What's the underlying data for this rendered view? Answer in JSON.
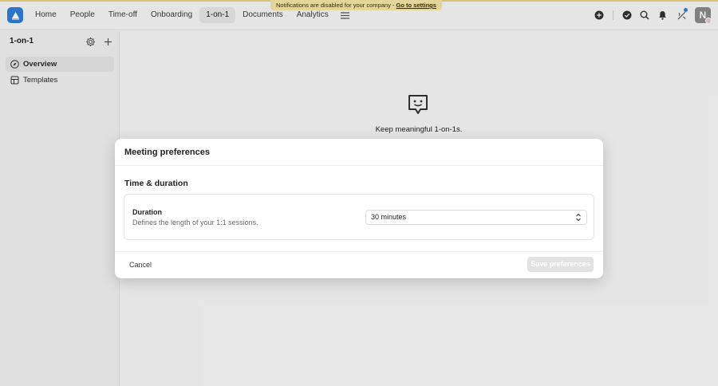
{
  "topbar": {
    "logo_icon": "app-logo-icon",
    "nav": [
      {
        "label": "Home",
        "active": false
      },
      {
        "label": "People",
        "active": false
      },
      {
        "label": "Time-off",
        "active": false
      },
      {
        "label": "Onboarding",
        "active": false
      },
      {
        "label": "1-on-1",
        "active": true
      },
      {
        "label": "Documents",
        "active": false
      },
      {
        "label": "Analytics",
        "active": false
      }
    ],
    "banner": {
      "text": "Notifications are disabled for your company - ",
      "link": "Go to settings"
    },
    "icons": [
      "plus-circle-icon",
      "check-circle-icon",
      "search-icon",
      "bell-icon",
      "sparkle-icon"
    ],
    "avatar_initial": "N"
  },
  "sidebar": {
    "title": "1-on-1",
    "items": [
      {
        "label": "Overview",
        "icon": "compass-icon",
        "active": true
      },
      {
        "label": "Templates",
        "icon": "template-icon",
        "active": false
      }
    ]
  },
  "main": {
    "empty_state_text": "Keep meaningful 1-on-1s."
  },
  "modal": {
    "title": "Meeting preferences",
    "section_title": "Time & duration",
    "field_label": "Duration",
    "field_description": "Defines the length of your 1:1 sessions.",
    "duration_value": "30 minutes",
    "cancel_label": "Cancel",
    "save_label": "Save preferences"
  },
  "colors": {
    "accent": "#2f7fd6",
    "banner": "#f6e6a6"
  }
}
